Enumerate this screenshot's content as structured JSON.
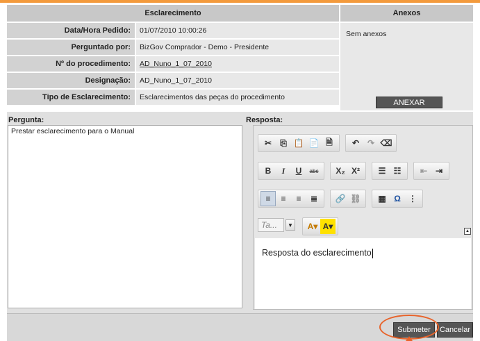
{
  "headers": {
    "esclarecimento": "Esclarecimento",
    "anexos": "Anexos"
  },
  "fields": [
    {
      "label": "Data/Hora Pedido:",
      "value": "01/07/2010 10:00:26"
    },
    {
      "label": "Perguntado por:",
      "value": "BizGov Comprador - Demo - Presidente"
    },
    {
      "label": "Nº do procedimento:",
      "value": "AD_Nuno_1_07_2010"
    },
    {
      "label": "Designação:",
      "value": "AD_Nuno_1_07_2010"
    },
    {
      "label": "Tipo de Esclarecimento:",
      "value": "Esclarecimentos das peças do procedimento"
    }
  ],
  "anexos": {
    "empty_text": "Sem anexos",
    "anexar_label": "ANEXAR"
  },
  "pergunta": {
    "label": "Pergunta:",
    "text": "Prestar esclarecimento para o Manual"
  },
  "resposta": {
    "label": "Resposta:",
    "text": "Resposta do esclarecimento",
    "font_placeholder": "Ta..."
  },
  "buttons": {
    "submeter": "Submeter",
    "cancelar": "Cancelar"
  },
  "colors": {
    "accent": "#f39a3c",
    "highlight": "#e8632a",
    "button": "#555555"
  }
}
